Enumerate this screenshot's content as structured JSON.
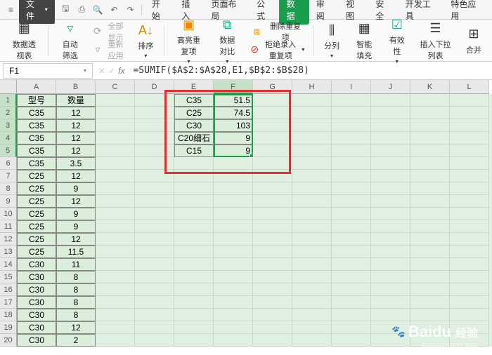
{
  "menu": {
    "file": "文件"
  },
  "tabs": [
    "开始",
    "插入",
    "页面布局",
    "公式",
    "数据",
    "审阅",
    "视图",
    "安全",
    "开发工具",
    "特色应用"
  ],
  "tabs_active_index": 4,
  "ribbon": {
    "pivot": "数据透视表",
    "autofilter": "自动筛选",
    "show_all": "全部显示",
    "reapply": "重新应用",
    "sort": "排序",
    "highlight_dup": "高亮重复项",
    "data_compare": "数据对比",
    "remove_dup": "删除重复项",
    "reject_dup": "拒绝录入重复项",
    "text_to_col": "分列",
    "smart_fill": "智能填充",
    "validation": "有效性",
    "dropdown": "插入下拉列表",
    "consolidate": "合并"
  },
  "name_box": "F1",
  "formula": "=SUMIF($A$2:$A$28,E1,$B$2:$B$28)",
  "columns": [
    "A",
    "B",
    "C",
    "D",
    "E",
    "F",
    "G",
    "H",
    "I",
    "J",
    "K",
    "L"
  ],
  "table_ab": {
    "header": [
      "型号",
      "数量"
    ],
    "rows": [
      [
        "C35",
        "12"
      ],
      [
        "C35",
        "12"
      ],
      [
        "C35",
        "12"
      ],
      [
        "C35",
        "12"
      ],
      [
        "C35",
        "3.5"
      ],
      [
        "C25",
        "12"
      ],
      [
        "C25",
        "9"
      ],
      [
        "C25",
        "12"
      ],
      [
        "C25",
        "9"
      ],
      [
        "C25",
        "9"
      ],
      [
        "C25",
        "12"
      ],
      [
        "C25",
        "11.5"
      ],
      [
        "C30",
        "11"
      ],
      [
        "C30",
        "8"
      ],
      [
        "C30",
        "8"
      ],
      [
        "C30",
        "8"
      ],
      [
        "C30",
        "8"
      ],
      [
        "C30",
        "12"
      ],
      [
        "C30",
        "2"
      ]
    ]
  },
  "summary": [
    [
      "C35",
      "51.5"
    ],
    [
      "C25",
      "74.5"
    ],
    [
      "C30",
      "103"
    ],
    [
      "C20细石",
      "9"
    ],
    [
      "C15",
      "9"
    ]
  ],
  "watermark": {
    "brand": "Baidu",
    "suffix": "经验",
    "url": "jingyan.baidu.com"
  }
}
